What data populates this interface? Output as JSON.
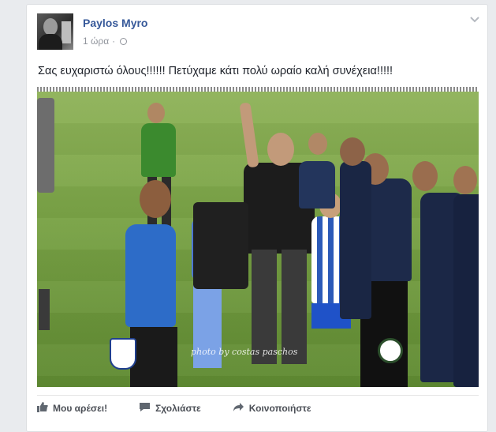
{
  "post": {
    "author": "Paylos Myro",
    "time": "1 ώρα",
    "separator": "·",
    "text": "Σας ευχαριστώ όλους!!!!!! Πετύχαμε κάτι πολύ ωραίο καλή συνέχεια!!!!!",
    "photo": {
      "watermark": "photo by costas paschos"
    }
  },
  "actions": {
    "like": "Μου αρέσει!",
    "comment": "Σχολιάστε",
    "share": "Κοινοποιήστε"
  },
  "icons": {
    "menu": "chevron-down-icon",
    "audience": "globe-icon",
    "like": "thumbs-up-icon",
    "comment": "comment-icon",
    "share": "share-arrow-icon"
  },
  "colors": {
    "author": "#365899",
    "meta": "#90949c",
    "background": "#e9ebee"
  }
}
